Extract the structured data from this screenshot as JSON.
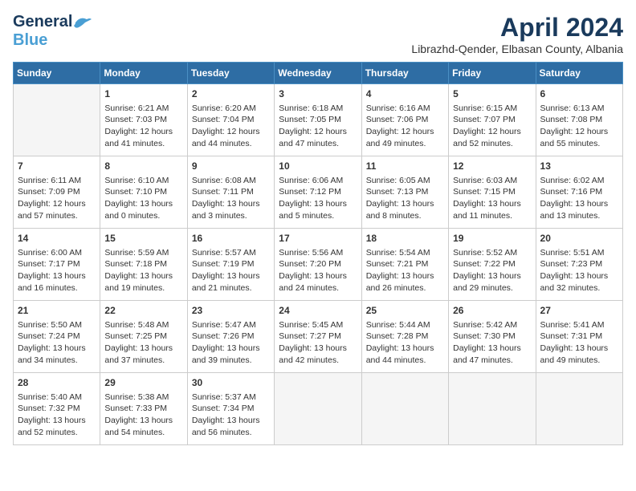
{
  "header": {
    "logo_general": "General",
    "logo_blue": "Blue",
    "month": "April 2024",
    "location": "Librazhd-Qender, Elbasan County, Albania"
  },
  "weekdays": [
    "Sunday",
    "Monday",
    "Tuesday",
    "Wednesday",
    "Thursday",
    "Friday",
    "Saturday"
  ],
  "weeks": [
    [
      {
        "day": null,
        "sunrise": null,
        "sunset": null,
        "daylight": null
      },
      {
        "day": "1",
        "sunrise": "6:21 AM",
        "sunset": "7:03 PM",
        "daylight": "12 hours and 41 minutes."
      },
      {
        "day": "2",
        "sunrise": "6:20 AM",
        "sunset": "7:04 PM",
        "daylight": "12 hours and 44 minutes."
      },
      {
        "day": "3",
        "sunrise": "6:18 AM",
        "sunset": "7:05 PM",
        "daylight": "12 hours and 47 minutes."
      },
      {
        "day": "4",
        "sunrise": "6:16 AM",
        "sunset": "7:06 PM",
        "daylight": "12 hours and 49 minutes."
      },
      {
        "day": "5",
        "sunrise": "6:15 AM",
        "sunset": "7:07 PM",
        "daylight": "12 hours and 52 minutes."
      },
      {
        "day": "6",
        "sunrise": "6:13 AM",
        "sunset": "7:08 PM",
        "daylight": "12 hours and 55 minutes."
      }
    ],
    [
      {
        "day": "7",
        "sunrise": "6:11 AM",
        "sunset": "7:09 PM",
        "daylight": "12 hours and 57 minutes."
      },
      {
        "day": "8",
        "sunrise": "6:10 AM",
        "sunset": "7:10 PM",
        "daylight": "13 hours and 0 minutes."
      },
      {
        "day": "9",
        "sunrise": "6:08 AM",
        "sunset": "7:11 PM",
        "daylight": "13 hours and 3 minutes."
      },
      {
        "day": "10",
        "sunrise": "6:06 AM",
        "sunset": "7:12 PM",
        "daylight": "13 hours and 5 minutes."
      },
      {
        "day": "11",
        "sunrise": "6:05 AM",
        "sunset": "7:13 PM",
        "daylight": "13 hours and 8 minutes."
      },
      {
        "day": "12",
        "sunrise": "6:03 AM",
        "sunset": "7:15 PM",
        "daylight": "13 hours and 11 minutes."
      },
      {
        "day": "13",
        "sunrise": "6:02 AM",
        "sunset": "7:16 PM",
        "daylight": "13 hours and 13 minutes."
      }
    ],
    [
      {
        "day": "14",
        "sunrise": "6:00 AM",
        "sunset": "7:17 PM",
        "daylight": "13 hours and 16 minutes."
      },
      {
        "day": "15",
        "sunrise": "5:59 AM",
        "sunset": "7:18 PM",
        "daylight": "13 hours and 19 minutes."
      },
      {
        "day": "16",
        "sunrise": "5:57 AM",
        "sunset": "7:19 PM",
        "daylight": "13 hours and 21 minutes."
      },
      {
        "day": "17",
        "sunrise": "5:56 AM",
        "sunset": "7:20 PM",
        "daylight": "13 hours and 24 minutes."
      },
      {
        "day": "18",
        "sunrise": "5:54 AM",
        "sunset": "7:21 PM",
        "daylight": "13 hours and 26 minutes."
      },
      {
        "day": "19",
        "sunrise": "5:52 AM",
        "sunset": "7:22 PM",
        "daylight": "13 hours and 29 minutes."
      },
      {
        "day": "20",
        "sunrise": "5:51 AM",
        "sunset": "7:23 PM",
        "daylight": "13 hours and 32 minutes."
      }
    ],
    [
      {
        "day": "21",
        "sunrise": "5:50 AM",
        "sunset": "7:24 PM",
        "daylight": "13 hours and 34 minutes."
      },
      {
        "day": "22",
        "sunrise": "5:48 AM",
        "sunset": "7:25 PM",
        "daylight": "13 hours and 37 minutes."
      },
      {
        "day": "23",
        "sunrise": "5:47 AM",
        "sunset": "7:26 PM",
        "daylight": "13 hours and 39 minutes."
      },
      {
        "day": "24",
        "sunrise": "5:45 AM",
        "sunset": "7:27 PM",
        "daylight": "13 hours and 42 minutes."
      },
      {
        "day": "25",
        "sunrise": "5:44 AM",
        "sunset": "7:28 PM",
        "daylight": "13 hours and 44 minutes."
      },
      {
        "day": "26",
        "sunrise": "5:42 AM",
        "sunset": "7:30 PM",
        "daylight": "13 hours and 47 minutes."
      },
      {
        "day": "27",
        "sunrise": "5:41 AM",
        "sunset": "7:31 PM",
        "daylight": "13 hours and 49 minutes."
      }
    ],
    [
      {
        "day": "28",
        "sunrise": "5:40 AM",
        "sunset": "7:32 PM",
        "daylight": "13 hours and 52 minutes."
      },
      {
        "day": "29",
        "sunrise": "5:38 AM",
        "sunset": "7:33 PM",
        "daylight": "13 hours and 54 minutes."
      },
      {
        "day": "30",
        "sunrise": "5:37 AM",
        "sunset": "7:34 PM",
        "daylight": "13 hours and 56 minutes."
      },
      {
        "day": null,
        "sunrise": null,
        "sunset": null,
        "daylight": null
      },
      {
        "day": null,
        "sunrise": null,
        "sunset": null,
        "daylight": null
      },
      {
        "day": null,
        "sunrise": null,
        "sunset": null,
        "daylight": null
      },
      {
        "day": null,
        "sunrise": null,
        "sunset": null,
        "daylight": null
      }
    ]
  ]
}
